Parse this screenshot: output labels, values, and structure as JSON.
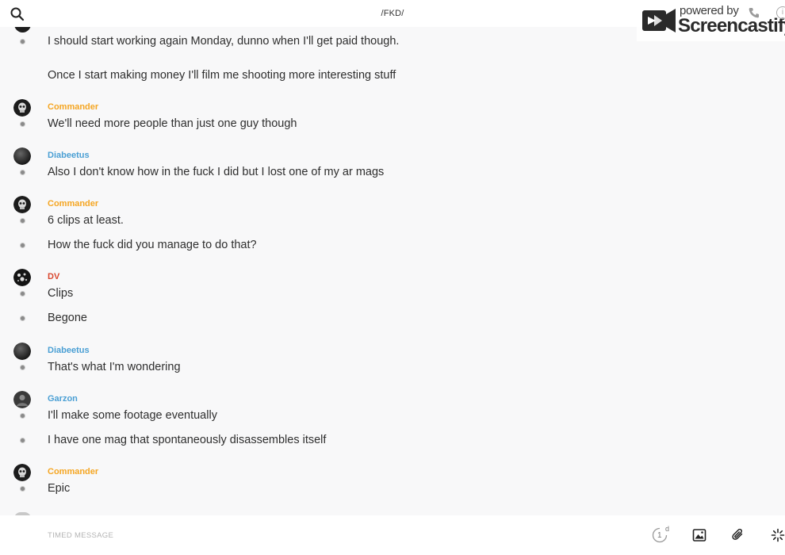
{
  "header": {
    "title": "/FKD/"
  },
  "watermark": {
    "powered": "powered by",
    "brand": "Screencastify"
  },
  "colors": {
    "Commander": "#f5a623",
    "Diabeetus": "#4a9fd4",
    "DV": "#d9472f",
    "Garzon": "#4a9fd4"
  },
  "messages": [
    {
      "texts": [
        "I should start working again Monday, dunno when I'll get paid though.",
        "Once I start making money I'll film me shooting more interesting stuff"
      ]
    },
    {
      "user": "Commander",
      "avatar": "commander-avatar",
      "texts": [
        "We'll need more people than just one guy though"
      ]
    },
    {
      "user": "Diabeetus",
      "avatar": "diabeetus-avatar",
      "texts": [
        "Also I don't know how in the fuck I did but I lost one of my ar mags"
      ]
    },
    {
      "user": "Commander",
      "avatar": "commander-avatar",
      "texts": [
        "6 clips at least.",
        "How the fuck did you manage to do that?"
      ]
    },
    {
      "user": "DV",
      "avatar": "dv-avatar",
      "texts": [
        "Clips",
        "Begone"
      ]
    },
    {
      "user": "Diabeetus",
      "avatar": "diabeetus-avatar",
      "texts": [
        "That's what I'm wondering"
      ]
    },
    {
      "user": "Garzon",
      "avatar": "garzon-avatar",
      "texts": [
        "I'll make some footage eventually",
        "I have one mag that spontaneously disassembles itself"
      ]
    },
    {
      "user": "Commander",
      "avatar": "commander-avatar",
      "texts": [
        "Epic"
      ]
    }
  ],
  "composer": {
    "placeholder": "TIMED MESSAGE",
    "timer_value": "1",
    "timer_unit": "d",
    "icons": [
      "timer-icon",
      "image-icon",
      "paperclip-icon",
      "sparkle-icon"
    ]
  }
}
